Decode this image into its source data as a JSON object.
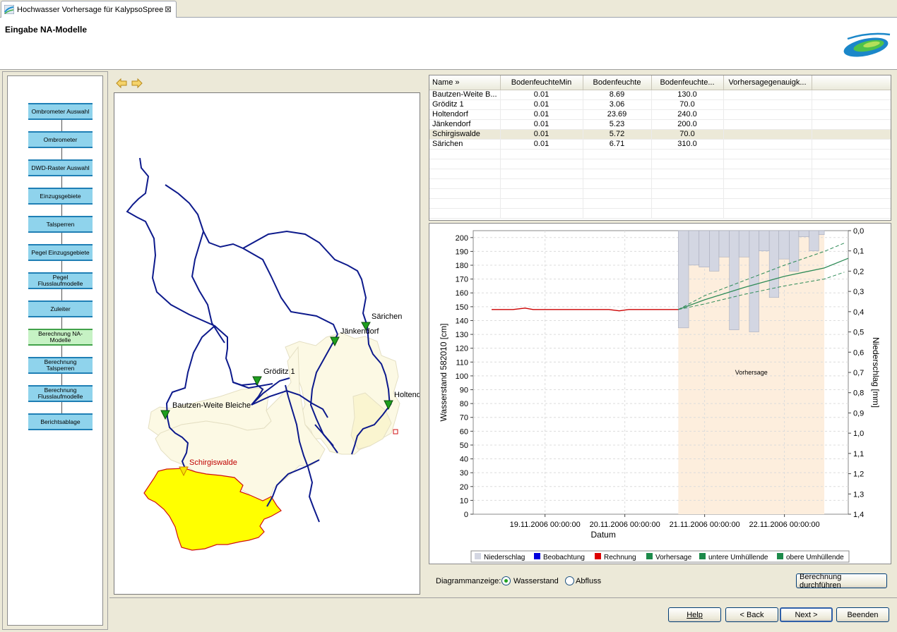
{
  "tab": {
    "title": "Hochwasser Vorhersage für KalypsoSpree",
    "close_glyph": "⊠"
  },
  "header": {
    "title": "Eingabe NA-Modelle"
  },
  "steps": [
    {
      "label": "Ombrometer Auswahl",
      "active": false
    },
    {
      "label": "Ombrometer",
      "active": false
    },
    {
      "label": "DWD-Raster Auswahl",
      "active": false
    },
    {
      "label": "Einzugsgebiete",
      "active": false
    },
    {
      "label": "Talsperren",
      "active": false
    },
    {
      "label": "Pegel Einzugsgebiete",
      "active": false
    },
    {
      "label": "Pegel Flusslaufmodelle",
      "active": false
    },
    {
      "label": "Zuleiter",
      "active": false
    },
    {
      "label": "Berechnung NA-Modelle",
      "active": true
    },
    {
      "label": "Berechnung Talsperren",
      "active": false
    },
    {
      "label": "Berechnung Flusslaufmodelle",
      "active": false
    },
    {
      "label": "Berichtsablage",
      "active": false
    }
  ],
  "map": {
    "labels": {
      "saerichen": "Särichen",
      "jaenkendorf": "Jänkendorf",
      "groeditz": "Gröditz 1",
      "holtendorf": "Holtend",
      "bautzen": "Bautzen-Weite Bleiche",
      "schirgiswalde": "Schirgiswalde"
    },
    "selected_color": "#ffff00",
    "basin_color": "#fcf9e4",
    "river_color": "#0d1a8c",
    "gauge_color": "#1e9e1e"
  },
  "table": {
    "columns": [
      "Name »",
      "BodenfeuchteMin",
      "Bodenfeuchte",
      "Bodenfeuchte...",
      "Vorhersagegenauigk..."
    ],
    "rows": [
      [
        "Bautzen-Weite B...",
        "0.01",
        "8.69",
        "130.0",
        ""
      ],
      [
        "Gröditz 1",
        "0.01",
        "3.06",
        "70.0",
        ""
      ],
      [
        "Holtendorf",
        "0.01",
        "23.69",
        "240.0",
        ""
      ],
      [
        "Jänkendorf",
        "0.01",
        "5.23",
        "200.0",
        ""
      ],
      [
        "Schirgiswalde",
        "0.01",
        "5.72",
        "70.0",
        ""
      ],
      [
        "Särichen",
        "0.01",
        "6.71",
        "310.0",
        ""
      ]
    ],
    "selected_row": 4
  },
  "chart_data": {
    "type": "line",
    "xlabel": "Datum",
    "ylabel": "Wasserstand 582010 [cm]",
    "y2label": "Niederschlag [mm]",
    "ylim": [
      0,
      205
    ],
    "y2lim": [
      0,
      1.4
    ],
    "y_ticks": [
      0,
      10,
      20,
      30,
      40,
      50,
      60,
      70,
      80,
      90,
      100,
      110,
      120,
      130,
      140,
      150,
      160,
      170,
      180,
      190,
      200
    ],
    "y2_ticks": [
      "0,0",
      "0,1",
      "0,2",
      "0,3",
      "0,4",
      "0,5",
      "0,6",
      "0,7",
      "0,8",
      "0,9",
      "1,0",
      "1,1",
      "1,2",
      "1,3",
      "1,4"
    ],
    "x_ticks": [
      "19.11.2006 00:00:00",
      "20.11.2006 00:00:00",
      "21.11.2006 00:00:00",
      "22.11.2006 00:00:00"
    ],
    "forecast_label": "Vorhersage",
    "forecast_start_day": 20.67,
    "forecast_end_day": 22.5,
    "x_range_days": [
      18.1,
      22.8
    ],
    "series": [
      {
        "name": "Rechnung",
        "color": "#cc0000",
        "points": [
          [
            18.33,
            148
          ],
          [
            18.6,
            148
          ],
          [
            18.75,
            149
          ],
          [
            18.85,
            148
          ],
          [
            19.2,
            148
          ],
          [
            19.8,
            148
          ],
          [
            19.93,
            147
          ],
          [
            20.05,
            148
          ],
          [
            20.67,
            148
          ]
        ]
      },
      {
        "name": "Vorhersage",
        "color": "#2e8b57",
        "points": [
          [
            20.67,
            148
          ],
          [
            21.0,
            155
          ],
          [
            21.5,
            164
          ],
          [
            22.0,
            172
          ],
          [
            22.5,
            178
          ],
          [
            22.8,
            185
          ]
        ]
      },
      {
        "name": "untere Umhüllende",
        "color": "#2e8b57",
        "dashed": true,
        "points": [
          [
            20.67,
            148
          ],
          [
            21.0,
            152
          ],
          [
            21.5,
            159
          ],
          [
            22.0,
            165
          ],
          [
            22.5,
            170
          ],
          [
            22.75,
            175
          ]
        ]
      },
      {
        "name": "obere Umhüllende",
        "color": "#2e8b57",
        "dashed": true,
        "points": [
          [
            20.67,
            148
          ],
          [
            21.0,
            158
          ],
          [
            21.5,
            169
          ],
          [
            22.0,
            180
          ],
          [
            22.5,
            190
          ],
          [
            22.75,
            196
          ]
        ]
      }
    ],
    "precipitation": [
      {
        "start": 20.67,
        "end": 20.8,
        "value": 0.48
      },
      {
        "start": 20.8,
        "end": 20.93,
        "value": 0.17
      },
      {
        "start": 20.93,
        "end": 21.06,
        "value": 0.18
      },
      {
        "start": 21.06,
        "end": 21.18,
        "value": 0.2
      },
      {
        "start": 21.18,
        "end": 21.31,
        "value": 0.13
      },
      {
        "start": 21.31,
        "end": 21.43,
        "value": 0.49
      },
      {
        "start": 21.43,
        "end": 21.56,
        "value": 0.13
      },
      {
        "start": 21.56,
        "end": 21.68,
        "value": 0.5
      },
      {
        "start": 21.68,
        "end": 21.81,
        "value": 0.1
      },
      {
        "start": 21.81,
        "end": 21.93,
        "value": 0.33
      },
      {
        "start": 21.93,
        "end": 22.06,
        "value": 0.14
      },
      {
        "start": 22.06,
        "end": 22.18,
        "value": 0.2
      },
      {
        "start": 22.18,
        "end": 22.31,
        "value": 0.03
      },
      {
        "start": 22.31,
        "end": 22.43,
        "value": 0.1
      },
      {
        "start": 22.43,
        "end": 22.5,
        "value": 0.02
      }
    ],
    "legend": [
      {
        "label": "Niederschlag",
        "color": "#d3d6e2"
      },
      {
        "label": "Beobachtung",
        "color": "#0000dd"
      },
      {
        "label": "Rechnung",
        "color": "#dd0000"
      },
      {
        "label": "Vorhersage",
        "color": "#1c8a4a"
      },
      {
        "label": "untere Umhüllende",
        "color": "#1c8a4a"
      },
      {
        "label": "obere Umhüllende",
        "color": "#1c8a4a"
      }
    ]
  },
  "controls": {
    "diagram_label": "Diagrammanzeige:",
    "option_wasserstand": "Wasserstand",
    "option_abfluss": "Abfluss",
    "selected_option": "Wasserstand",
    "run_button": "Berechnung durchführen"
  },
  "footer": {
    "help": "Help",
    "back": "< Back",
    "next": "Next >",
    "finish": "Beenden"
  }
}
